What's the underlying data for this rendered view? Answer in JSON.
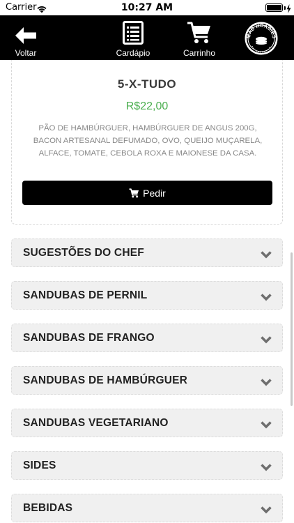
{
  "status_bar": {
    "carrier": "Carrier",
    "time": "10:27 AM",
    "battery_level": 1.0
  },
  "nav": {
    "back_label": "Voltar",
    "menu_label": "Cardápio",
    "cart_label": "Carrinho",
    "logo_text": "MAD HOAGIES"
  },
  "product": {
    "name": "5-X-TUDO",
    "price": "R$22,00",
    "description": "PÃO DE HAMBÚRGUER, HAMBÚRGUER DE ANGUS 200G, BACON ARTESANAL DEFUMADO, OVO, QUEIJO MUÇARELA, ALFACE, TOMATE, CEBOLA ROXA E MAIONESE DA CASA.",
    "order_label": "Pedir"
  },
  "categories": [
    {
      "label": "SUGESTÕES DO CHEF"
    },
    {
      "label": "SANDUBAS DE PERNIL"
    },
    {
      "label": "SANDUBAS DE FRANGO"
    },
    {
      "label": "SANDUBAS DE HAMBÚRGUER"
    },
    {
      "label": "SANDUBAS VEGETARIANO"
    },
    {
      "label": "SIDES"
    },
    {
      "label": "BEBIDAS"
    }
  ],
  "colors": {
    "nav_bg": "#000000",
    "price": "#4caf50",
    "category_bg": "#f0f0f0",
    "button_bg": "#000000"
  },
  "icons": [
    "wifi-icon",
    "battery-icon",
    "back-arrow-icon",
    "menu-list-icon",
    "cart-icon",
    "chevron-down-icon"
  ]
}
